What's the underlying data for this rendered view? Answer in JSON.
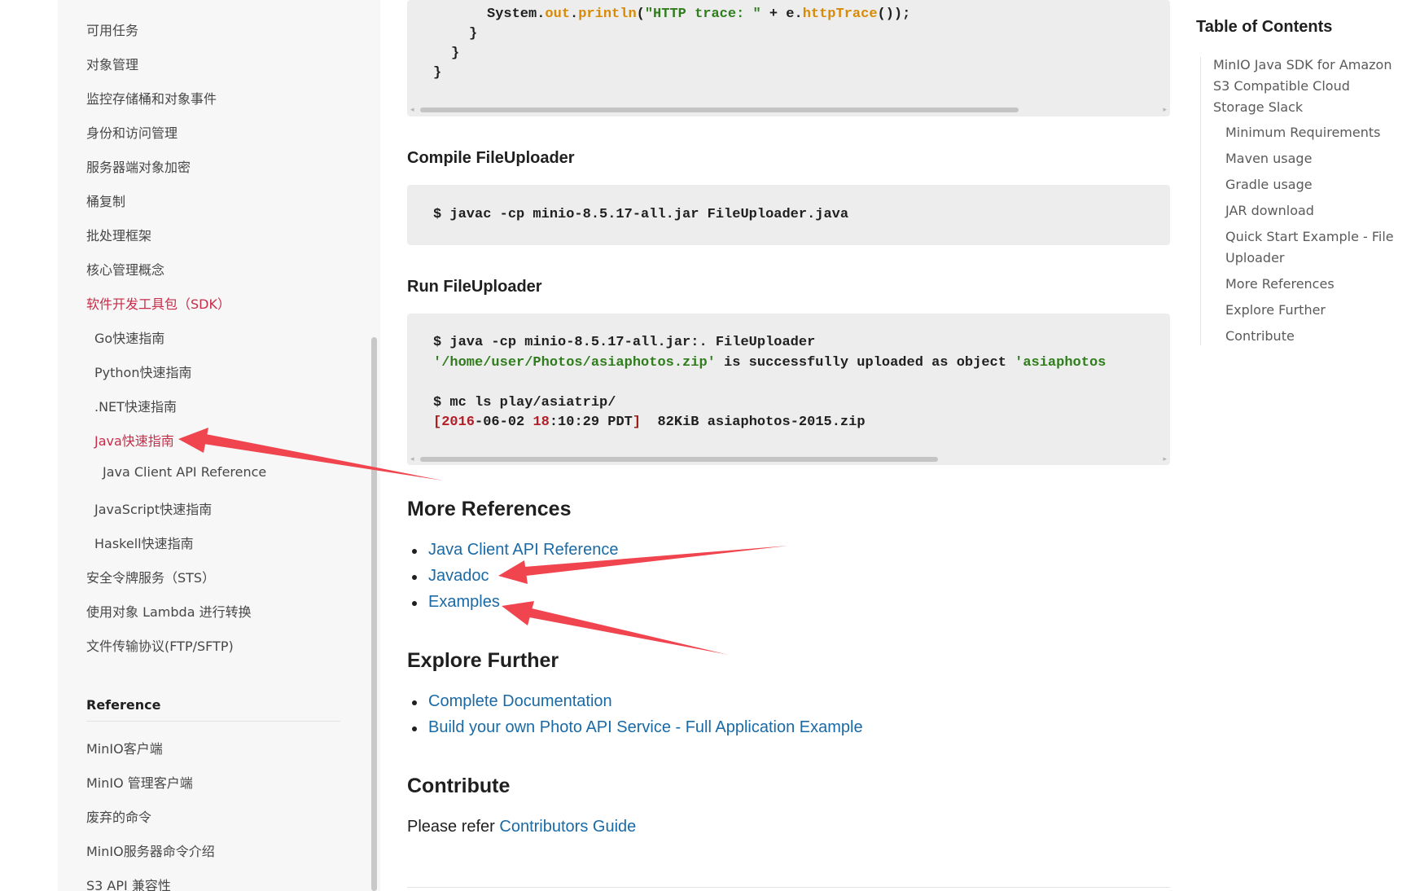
{
  "sidebar": {
    "items": [
      {
        "label": "可用任务",
        "active": false
      },
      {
        "label": "对象管理",
        "active": false
      },
      {
        "label": "监控存储桶和对象事件",
        "active": false
      },
      {
        "label": "身份和访问管理",
        "active": false
      },
      {
        "label": "服务器端对象加密",
        "active": false
      },
      {
        "label": "桶复制",
        "active": false
      },
      {
        "label": "批处理框架",
        "active": false
      },
      {
        "label": "核心管理概念",
        "active": false
      },
      {
        "label": "软件开发工具包（SDK）",
        "active": true
      },
      {
        "label": "Go快速指南",
        "active": false
      },
      {
        "label": "Python快速指南",
        "active": false
      },
      {
        "label": ".NET快速指南",
        "active": false
      },
      {
        "label": "Java快速指南",
        "active": true
      },
      {
        "label": "Java Client API Reference",
        "active": false
      },
      {
        "label": "JavaScript快速指南",
        "active": false
      },
      {
        "label": "Haskell快速指南",
        "active": false
      },
      {
        "label": "安全令牌服务（STS）",
        "active": false
      },
      {
        "label": "使用对象 Lambda 进行转换",
        "active": false
      },
      {
        "label": "文件传输协议(FTP/SFTP)",
        "active": false
      }
    ],
    "reference_title": "Reference",
    "reference_items": [
      {
        "label": "MinIO客户端"
      },
      {
        "label": "MinIO 管理客户端"
      },
      {
        "label": "废弃的命令"
      },
      {
        "label": "MinIO服务器命令介绍"
      },
      {
        "label": "S3 API 兼容性"
      }
    ]
  },
  "code_top": {
    "line1_pre": "System.",
    "line1_field": "out",
    "line1_dot": ".",
    "line1_method": "println",
    "line1_open": "(",
    "line1_str": "\"HTTP trace: \"",
    "line1_plus": " + e.",
    "line1_call": "httpTrace",
    "line1_end": "());",
    "line2": "}",
    "line3": "}",
    "line4": "}"
  },
  "compile": {
    "heading": "Compile FileUploader",
    "command": "$ javac -cp minio-8.5.17-all.jar FileUploader.java"
  },
  "run": {
    "heading": "Run FileUploader",
    "line1": "$ java -cp minio-8.5.17-all.jar:. FileUploader",
    "line2_str1": "'/home/user/Photos/asiaphotos.zip'",
    "line2_mid": " is successfully uploaded as object ",
    "line2_str2": "'asiaphotos",
    "line3": "$ mc ls play/asiatrip/",
    "line4_open": "[",
    "line4_year": "2016",
    "line4_date": "-06-02 ",
    "line4_hour": "18",
    "line4_time": ":10:29 PDT",
    "line4_close": "]",
    "line4_rest": "  82KiB asiaphotos-2015.zip"
  },
  "more_references": {
    "heading": "More References",
    "links": [
      "Java Client API Reference",
      "Javadoc",
      "Examples"
    ]
  },
  "explore_further": {
    "heading": "Explore Further",
    "links": [
      "Complete Documentation",
      "Build your own Photo API Service - Full Application Example"
    ]
  },
  "contribute": {
    "heading": "Contribute",
    "text": "Please refer ",
    "link": "Contributors Guide"
  },
  "toc": {
    "title": "Table of Contents",
    "items": [
      {
        "label": "MinIO Java SDK for Amazon S3 Compatible Cloud Storage Slack",
        "level": 1
      },
      {
        "label": "Minimum Requirements",
        "level": 2
      },
      {
        "label": "Maven usage",
        "level": 2
      },
      {
        "label": "Gradle usage",
        "level": 2
      },
      {
        "label": "JAR download",
        "level": 2
      },
      {
        "label": "Quick Start Example - File Uploader",
        "level": 2
      },
      {
        "label": "More References",
        "level": 2
      },
      {
        "label": "Explore Further",
        "level": 2
      },
      {
        "label": "Contribute",
        "level": 2
      }
    ]
  },
  "colors": {
    "active_link": "#c72c48",
    "link": "#1a6aa6",
    "annotation_arrow": "#f0444e",
    "code_background": "#ededed"
  }
}
